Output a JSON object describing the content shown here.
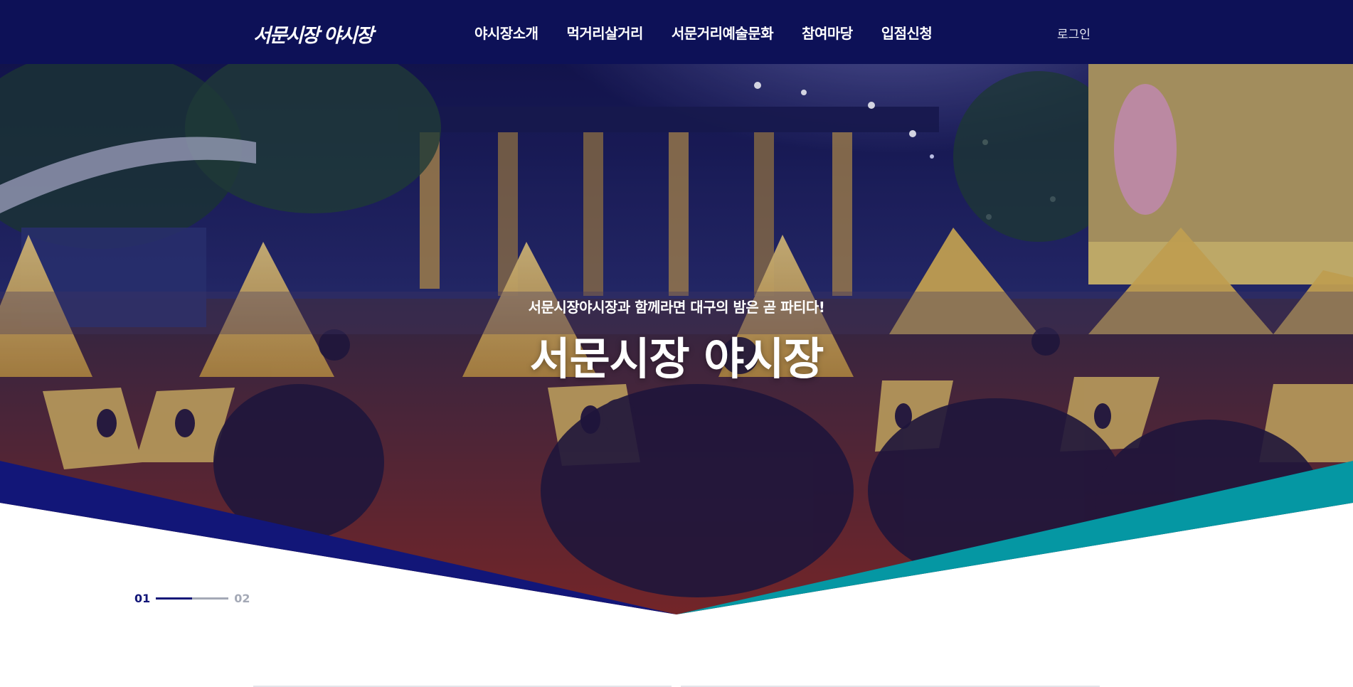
{
  "header": {
    "logo_text": "서문시장 야시장",
    "nav": [
      {
        "label": "야시장소개"
      },
      {
        "label": "먹거리살거리"
      },
      {
        "label": "서문거리예술문화"
      },
      {
        "label": "참여마당"
      },
      {
        "label": "입점신청"
      }
    ],
    "login_label": "로그인"
  },
  "hero": {
    "subtitle": "서문시장야시장과 함께라면 대구의 밤은 곧 파티다!",
    "title": "서문시장 야시장"
  },
  "slider": {
    "current": "01",
    "next": "02",
    "progress": 0.5
  },
  "colors": {
    "header_bg": "#0d1157",
    "accent_navy": "#121678",
    "accent_teal": "#0597a3",
    "tent_yellow": "#e7bd4f",
    "overlay_red": "#7a2525"
  }
}
